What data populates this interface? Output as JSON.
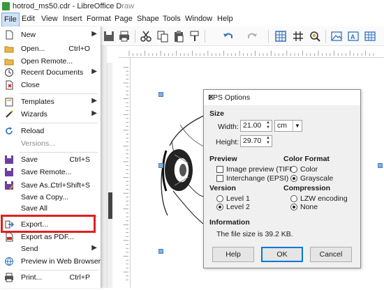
{
  "window": {
    "title_main": "hotrod_ms50.cdr - LibreOffice D",
    "title_dim": "raw"
  },
  "menubar": {
    "items": [
      "File",
      "Edit",
      "View",
      "Insert",
      "Format",
      "Page",
      "Shape",
      "Tools",
      "Window",
      "Help"
    ]
  },
  "file_menu": {
    "items": [
      {
        "label": "New",
        "shortcut": "",
        "submenu": true,
        "icon": "new-document-icon"
      },
      {
        "label": "Open...",
        "shortcut": "Ctrl+O",
        "icon": "open-folder-icon"
      },
      {
        "label": "Open Remote...",
        "shortcut": "",
        "icon": "open-remote-icon"
      },
      {
        "label": "Recent Documents",
        "shortcut": "",
        "submenu": true,
        "icon": "recent-documents-icon"
      },
      {
        "label": "Close",
        "shortcut": "",
        "icon": "close-document-icon"
      },
      {
        "label": "Templates",
        "shortcut": "",
        "submenu": true,
        "icon": "templates-icon"
      },
      {
        "label": "Wizards",
        "shortcut": "",
        "submenu": true,
        "icon": "wizards-icon"
      },
      {
        "label": "Reload",
        "shortcut": "",
        "icon": "reload-icon"
      },
      {
        "label": "Versions...",
        "shortcut": "",
        "disabled": true
      },
      {
        "label": "Save",
        "shortcut": "Ctrl+S",
        "icon": "save-icon"
      },
      {
        "label": "Save Remote...",
        "shortcut": "",
        "icon": "save-remote-icon"
      },
      {
        "label": "Save As...",
        "shortcut": "Ctrl+Shift+S",
        "icon": "save-as-icon"
      },
      {
        "label": "Save a Copy...",
        "shortcut": ""
      },
      {
        "label": "Save All",
        "shortcut": ""
      },
      {
        "label": "Export...",
        "shortcut": "",
        "icon": "export-icon"
      },
      {
        "label": "Export as PDF...",
        "shortcut": "",
        "icon": "export-pdf-icon"
      },
      {
        "label": "Send",
        "shortcut": "",
        "submenu": true
      },
      {
        "label": "Preview in Web Browser",
        "shortcut": "",
        "icon": "web-preview-icon"
      },
      {
        "label": "Print...",
        "shortcut": "Ctrl+P",
        "icon": "print-icon"
      }
    ]
  },
  "eps_dialog": {
    "title": "EPS Options",
    "size": {
      "heading": "Size",
      "width_label": "Width:",
      "width_value": "21.00",
      "unit": "cm",
      "height_label": "Height:",
      "height_value": "29.70"
    },
    "preview": {
      "heading": "Preview",
      "image_preview": "Image preview (TIFF)",
      "image_preview_checked": false,
      "interchange": "Interchange (EPSI)",
      "interchange_checked": false
    },
    "color_format": {
      "heading": "Color Format",
      "color": "Color",
      "grayscale": "Grayscale",
      "selected": "Grayscale"
    },
    "version": {
      "heading": "Version",
      "level1": "Level 1",
      "level2": "Level 2",
      "selected": "Level 2"
    },
    "compression": {
      "heading": "Compression",
      "lzw": "LZW encoding",
      "none": "None",
      "selected": "None"
    },
    "information": {
      "heading": "Information",
      "text": "The file size is 39.2 KB."
    },
    "buttons": {
      "help": "Help",
      "ok": "OK",
      "cancel": "Cancel"
    }
  }
}
